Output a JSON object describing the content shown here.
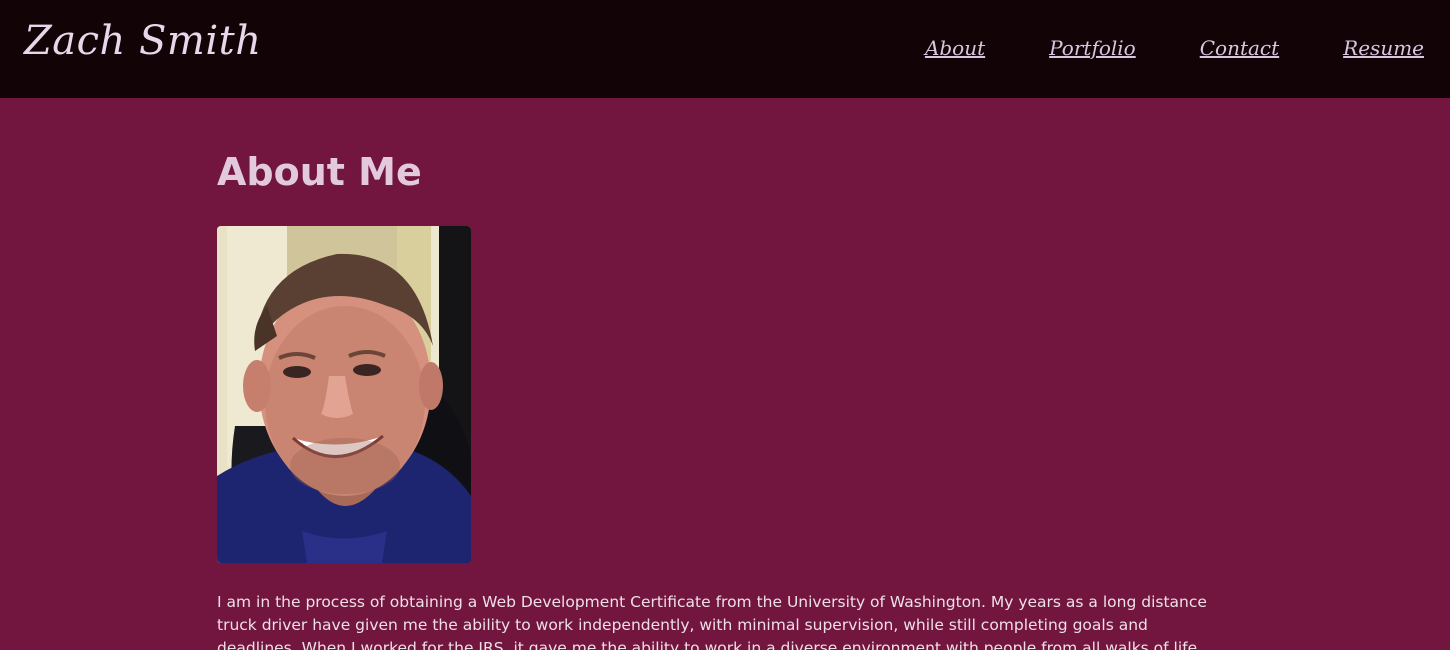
{
  "header": {
    "brand": "Zach Smith",
    "nav": [
      {
        "label": "About"
      },
      {
        "label": "Portfolio"
      },
      {
        "label": "Contact"
      },
      {
        "label": "Resume"
      }
    ]
  },
  "main": {
    "title": "About Me",
    "bio": "I am in the process of obtaining a Web Development Certificate from the University of Washington. My years as a long distance truck driver have given me the ability to work independently, with minimal supervision, while still completing goals and deadlines. When I worked for the IRS, it gave me the ability to work in a diverse environment with people from all walks of life."
  },
  "colors": {
    "header_bg": "#120307",
    "page_bg": "#72163f",
    "text": "#efdfe8"
  }
}
